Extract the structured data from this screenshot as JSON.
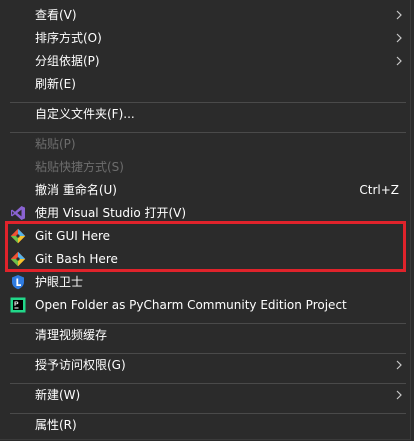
{
  "menu": {
    "items": [
      {
        "label": "查看(V)"
      },
      {
        "label": "排序方式(O)"
      },
      {
        "label": "分组依据(P)"
      },
      {
        "label": "刷新(E)"
      },
      {
        "label": "自定义文件夹(F)..."
      },
      {
        "label": "粘贴(P)"
      },
      {
        "label": "粘贴快捷方式(S)"
      },
      {
        "label": "撤消 重命名(U)",
        "shortcut": "Ctrl+Z"
      },
      {
        "label": "使用 Visual Studio 打开(V)",
        "icon": "visual-studio-icon"
      },
      {
        "label": "Git GUI Here",
        "icon": "git-icon"
      },
      {
        "label": "Git Bash Here",
        "icon": "git-icon"
      },
      {
        "label": "护眼卫士",
        "icon": "eye-guard-icon"
      },
      {
        "label": "Open Folder as PyCharm Community Edition Project",
        "icon": "pycharm-icon"
      },
      {
        "label": "清理视频缓存"
      },
      {
        "label": "授予访问权限(G)"
      },
      {
        "label": "新建(W)"
      },
      {
        "label": "属性(R)"
      }
    ]
  },
  "colors": {
    "background": "#2b2b2b",
    "text": "#ffffff",
    "disabled_text": "#6d6d6d",
    "separator": "#4a4a4a",
    "highlight_border": "#e0232b"
  }
}
